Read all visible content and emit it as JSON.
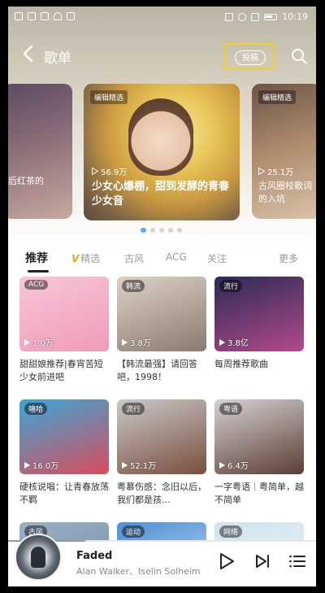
{
  "status_bar": {
    "time": "10:19"
  },
  "header": {
    "title": "歌单",
    "contribute_label": "投稿"
  },
  "banners": {
    "left": {
      "text": "后红茶的"
    },
    "main": {
      "tag": "编辑精选",
      "play_count": "56.9万",
      "title": "少女心爆棚，甜到发酵的青春少女音"
    },
    "right": {
      "tag": "编辑精选",
      "play_count": "25.1万",
      "text": "古风圈校歌词的入坑"
    }
  },
  "pager": {
    "count": 5,
    "active": 0
  },
  "tabs": {
    "recommend": "推荐",
    "vip_mark": "V",
    "featured": "精选",
    "gufeng": "古风",
    "acg": "ACG",
    "follow": "关注",
    "more": "更多"
  },
  "cards": [
    {
      "tag": "ACG",
      "count": "1.0万",
      "title": "甜甜娘推荐|春宵苦短 少女前进吧",
      "colors": [
        "#f7c6d9",
        "#f09ab9"
      ]
    },
    {
      "tag": "韩流",
      "count": "3.8万",
      "title": "【韩流最强】请回答吧，1998！",
      "colors": [
        "#ddd1c5",
        "#8a7a6f"
      ]
    },
    {
      "tag": "流行",
      "count": "3.8亿",
      "title": "每周推荐歌曲",
      "colors": [
        "#2c2a57",
        "#b34a8a"
      ]
    },
    {
      "tag": "嘻哈",
      "count": "16.0万",
      "title": "硬核说唱：让青春放荡不羁",
      "colors": [
        "#3aa7d6",
        "#d94c5d"
      ]
    },
    {
      "tag": "流行",
      "count": "52.1万",
      "title": "粤慕伤感：念旧以后，我们都是孩...",
      "colors": [
        "#c9c9c9",
        "#7a4e3d"
      ]
    },
    {
      "tag": "粤语",
      "count": "6.4万",
      "title": "一字粤语｜粤简单，越不简单",
      "colors": [
        "#d6d2d3",
        "#5b3d33"
      ]
    },
    {
      "tag": "古风",
      "count": "",
      "title": "",
      "colors": [
        "#9bb0c4",
        "#6f8da8"
      ]
    },
    {
      "tag": "运动",
      "count": "",
      "title": "",
      "colors": [
        "#4f8fd6",
        "#c5dcf0"
      ]
    },
    {
      "tag": "网络",
      "count": "",
      "title": "",
      "colors": [
        "#cfe3ee",
        "#e9f2f6"
      ]
    }
  ],
  "player": {
    "song": "Faded",
    "artist": "Alan Walker、Iselin Solheim",
    "progress": 0.25
  }
}
